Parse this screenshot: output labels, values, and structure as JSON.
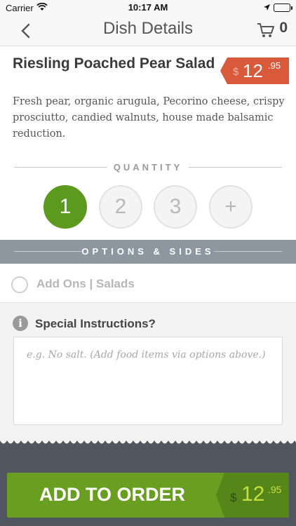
{
  "status_bar": {
    "carrier": "Carrier",
    "time": "10:17 AM"
  },
  "nav": {
    "title": "Dish Details",
    "cart_count": "0",
    "icons": [
      "back-chevron-icon",
      "cart-icon"
    ]
  },
  "dish": {
    "name": "Riesling Poached Pear Salad",
    "description": "Fresh pear, organic arugula, Pecorino cheese, crispy prosciutto, candied walnuts, house made balsamic reduction.",
    "price": {
      "currency": "$",
      "whole": "12",
      "cents": ".95"
    }
  },
  "quantity": {
    "label": "QUANTITY",
    "options": [
      "1",
      "2",
      "3",
      "+"
    ],
    "selected": "1"
  },
  "options": {
    "label": "OPTIONS & SIDES",
    "items": [
      {
        "label": "Add Ons | Salads",
        "selected": false
      }
    ]
  },
  "special": {
    "label": "Special Instructions?",
    "placeholder": "e.g. No salt. (Add food items via options above.)"
  },
  "footer": {
    "button_label": "ADD TO ORDER",
    "price": {
      "currency": "$",
      "whole": "12",
      "cents": ".95"
    }
  },
  "colors": {
    "accent_green": "#6a9e21",
    "price_red": "#d95a3b",
    "options_bar": "#8c97a0"
  }
}
